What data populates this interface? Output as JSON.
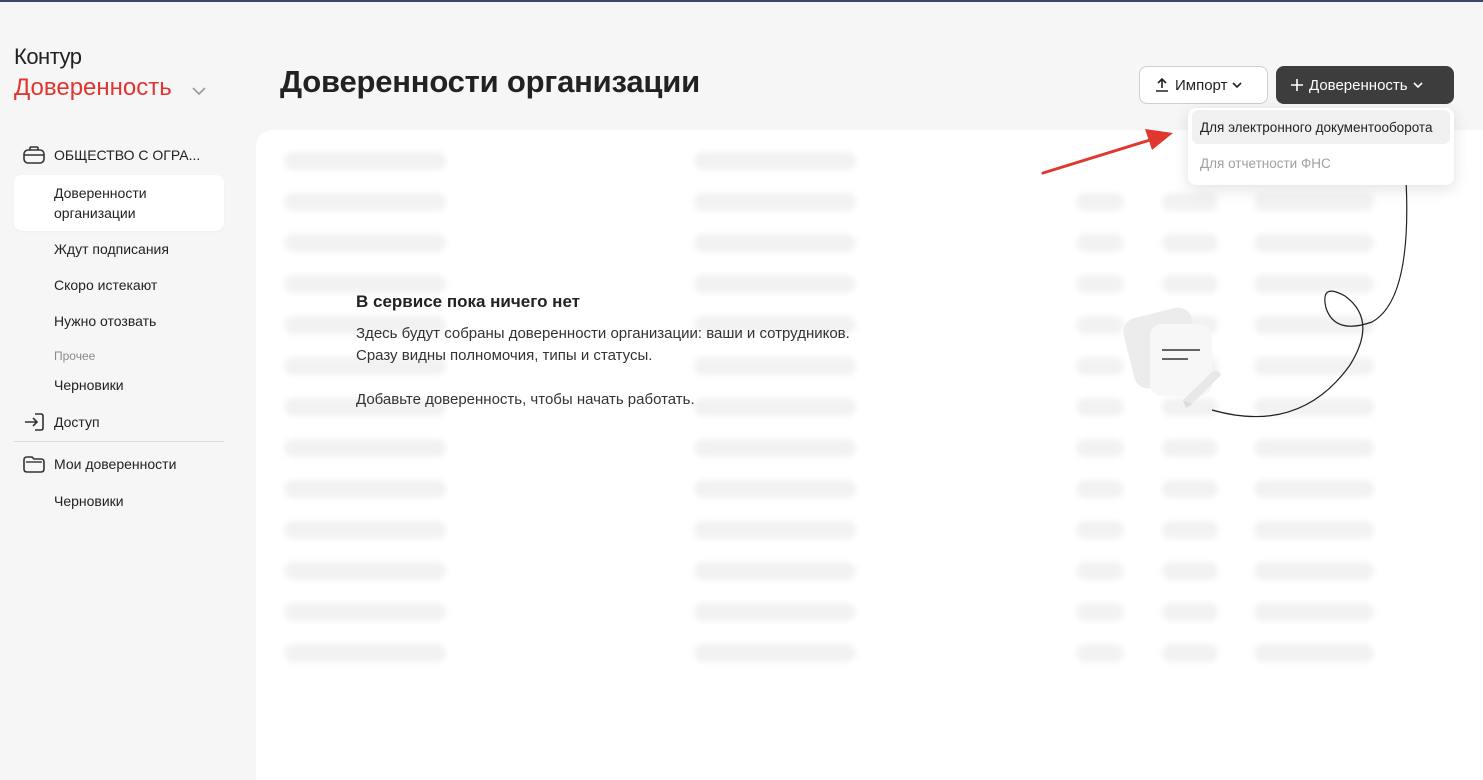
{
  "header": {
    "brand": "Контур",
    "product": "Доверенность",
    "page_title": "Доверенности организации"
  },
  "sidebar": {
    "org_name": "ОБЩЕСТВО С ОГРА...",
    "items": [
      {
        "label": "Доверенности организации"
      },
      {
        "label": "Ждут подписания"
      },
      {
        "label": "Скоро истекают"
      },
      {
        "label": "Нужно отозвать"
      }
    ],
    "other_label": "Прочее",
    "drafts_label": "Черновики",
    "access_label": "Доступ",
    "my_label": "Мои доверенности",
    "my_drafts_label": "Черновики"
  },
  "toolbar": {
    "import_label": "Импорт",
    "power_label": "Доверенность"
  },
  "dropdown": {
    "items": [
      {
        "label": "Для электронного документооборота",
        "disabled": false
      },
      {
        "label": "Для отчетности ФНС",
        "disabled": true
      }
    ]
  },
  "empty_state": {
    "title": "В сервисе пока ничего нет",
    "line1": "Здесь будут собраны доверенности организации: ваши и сотрудников.",
    "line2": "Сразу видны полномочия, типы и статусы.",
    "line3": "Добавьте доверенность, чтобы начать работать."
  },
  "colors": {
    "brand_red": "#e2352f",
    "dark_button": "#3d3d3d",
    "annotation_arrow": "#e0382f"
  }
}
